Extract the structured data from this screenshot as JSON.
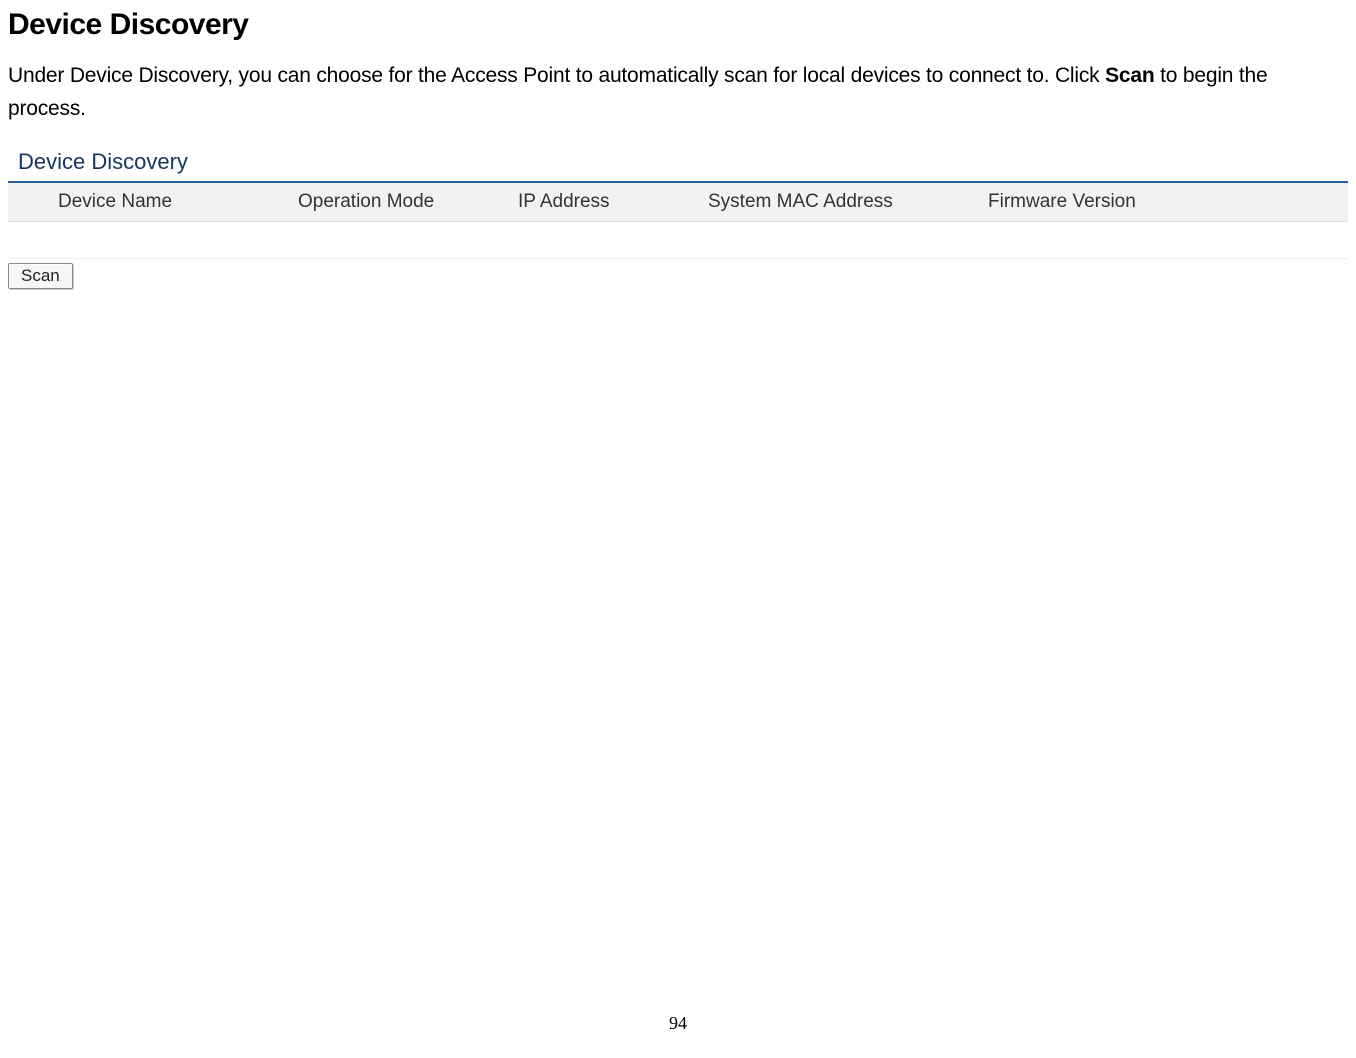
{
  "section": {
    "title": "Device Discovery",
    "intro_pre": "Under Device Discovery, you can choose for the Access Point to automatically scan for local devices to connect to. Click ",
    "intro_bold": "Scan",
    "intro_post": " to begin the process."
  },
  "panel": {
    "title": "Device Discovery",
    "columns": [
      "Device Name",
      "Operation Mode",
      "IP Address",
      "System MAC Address",
      "Firmware Version"
    ],
    "scan_button_label": "Scan"
  },
  "page_number": "94"
}
